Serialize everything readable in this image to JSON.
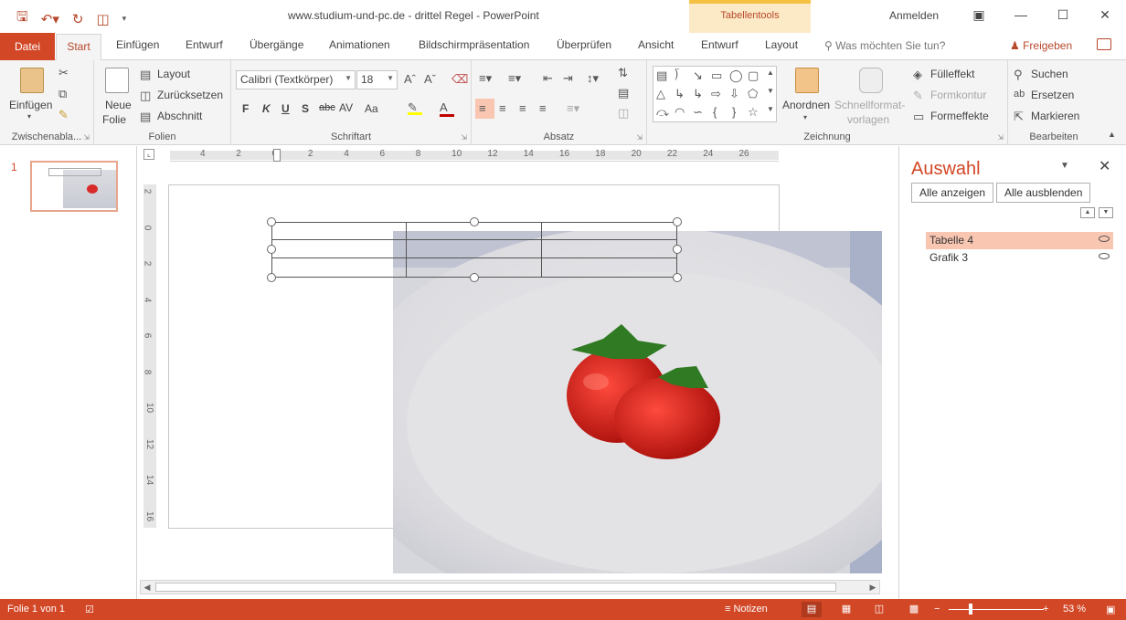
{
  "window": {
    "title": "www.studium-und-pc.de - drittel Regel  -  PowerPoint",
    "contextual_tab": "Tabellentools",
    "signin": "Anmelden",
    "accent_color": "#d24726"
  },
  "qat": {
    "save_icon": "floppy-icon",
    "undo_icon": "undo-icon",
    "redo_icon": "redo-icon",
    "present_icon": "present-icon"
  },
  "tabs": {
    "file": "Datei",
    "items": [
      "Start",
      "Einfügen",
      "Entwurf",
      "Übergänge",
      "Animationen",
      "Bildschirmpräsentation",
      "Überprüfen",
      "Ansicht",
      "Entwurf",
      "Layout"
    ],
    "tell_me": "Was möchten Sie tun?",
    "share": "Freigeben"
  },
  "ribbon": {
    "clipboard": {
      "paste": "Einfügen",
      "label": "Zwischenabla..."
    },
    "slides": {
      "new_slide_1": "Neue",
      "new_slide_2": "Folie",
      "layout": "Layout",
      "reset": "Zurücksetzen",
      "section": "Abschnitt",
      "label": "Folien"
    },
    "font": {
      "family": "Calibri (Textkörper)",
      "size": "18",
      "label": "Schriftart",
      "bold": "F",
      "italic": "K",
      "underline": "U",
      "shadow": "S",
      "strike": "abc",
      "spacing": "AV",
      "case": "Aa"
    },
    "paragraph": {
      "label": "Absatz"
    },
    "drawing": {
      "arrange": "Anordnen",
      "quick_styles_1": "Schnellformat-",
      "quick_styles_2": "vorlagen",
      "fill": "Fülleffekt",
      "outline": "Formkontur",
      "effects": "Formeffekte",
      "label": "Zeichnung"
    },
    "editing": {
      "find": "Suchen",
      "replace": "Ersetzen",
      "select": "Markieren",
      "label": "Bearbeiten"
    }
  },
  "thumbnails": {
    "slide_number": "1"
  },
  "ruler": {
    "h_numbers": [
      "4",
      "2",
      "0",
      "2",
      "4",
      "6",
      "8",
      "10",
      "12",
      "14",
      "16",
      "18",
      "20",
      "22",
      "24",
      "26"
    ],
    "v_numbers": [
      "2",
      "0",
      "2",
      "4",
      "6",
      "8",
      "10",
      "12",
      "14",
      "16"
    ]
  },
  "selection_pane": {
    "title": "Auswahl",
    "show_all": "Alle anzeigen",
    "hide_all": "Alle ausblenden",
    "items": [
      {
        "name": "Tabelle 4",
        "selected": true
      },
      {
        "name": "Grafik 3",
        "selected": false
      }
    ]
  },
  "status": {
    "slide_info": "Folie 1 von 1",
    "notes": "Notizen",
    "zoom": "53 %"
  }
}
